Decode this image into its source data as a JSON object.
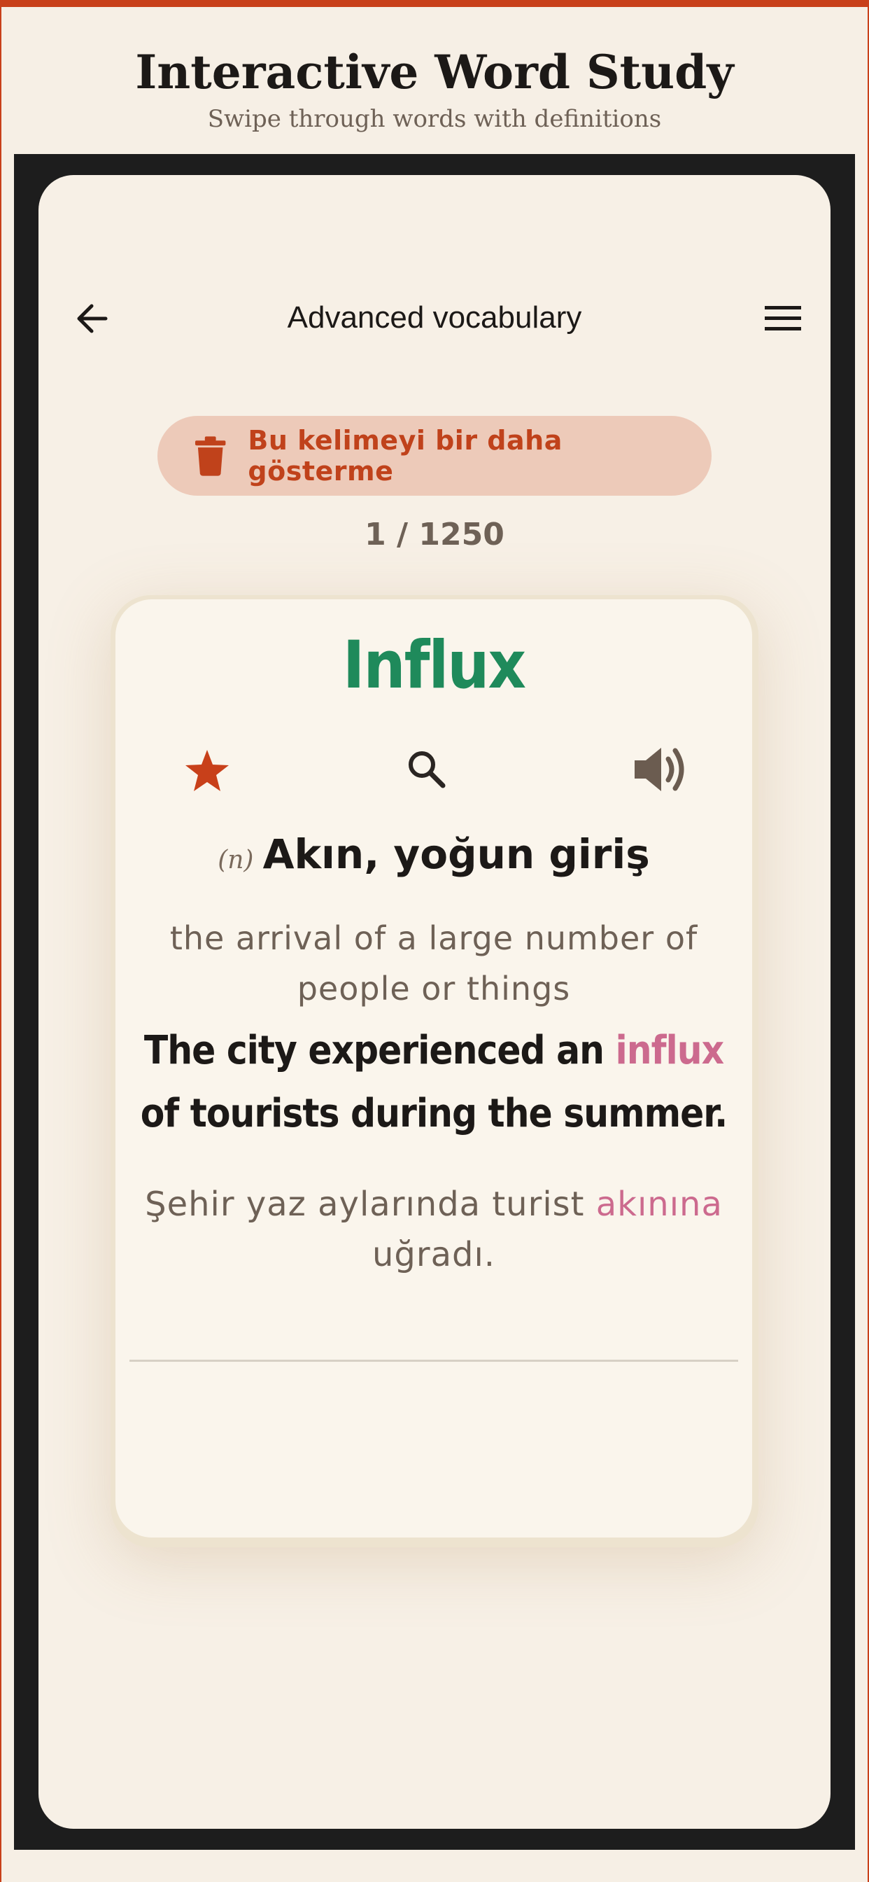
{
  "page": {
    "title": "Interactive Word Study",
    "subtitle": "Swipe through words with definitions"
  },
  "app_bar": {
    "title": "Advanced vocabulary",
    "back_icon": "arrow-left-icon",
    "menu_icon": "hamburger-menu-icon"
  },
  "hide_button": {
    "label": "Bu kelimeyi bir daha gösterme",
    "icon": "trash-icon"
  },
  "counter": "1 / 1250",
  "card": {
    "word": "Influx",
    "part_of_speech": "(n)",
    "translation": "Akın, yoğun giriş",
    "definition": "the arrival of a large number of people or things",
    "example_en": {
      "before": "The city experienced an ",
      "highlight": "influx",
      "after": " of tourists during the summer."
    },
    "example_tr": {
      "before": "Şehir yaz aylarında turist ",
      "highlight": "akınına",
      "after": " uğradı."
    },
    "icons": [
      "star-icon",
      "search-icon",
      "speaker-icon"
    ]
  },
  "colors": {
    "accent": "#c8401a",
    "word": "#1f8a5b",
    "highlight": "#cc6a8e",
    "background": "#f6efe5"
  }
}
